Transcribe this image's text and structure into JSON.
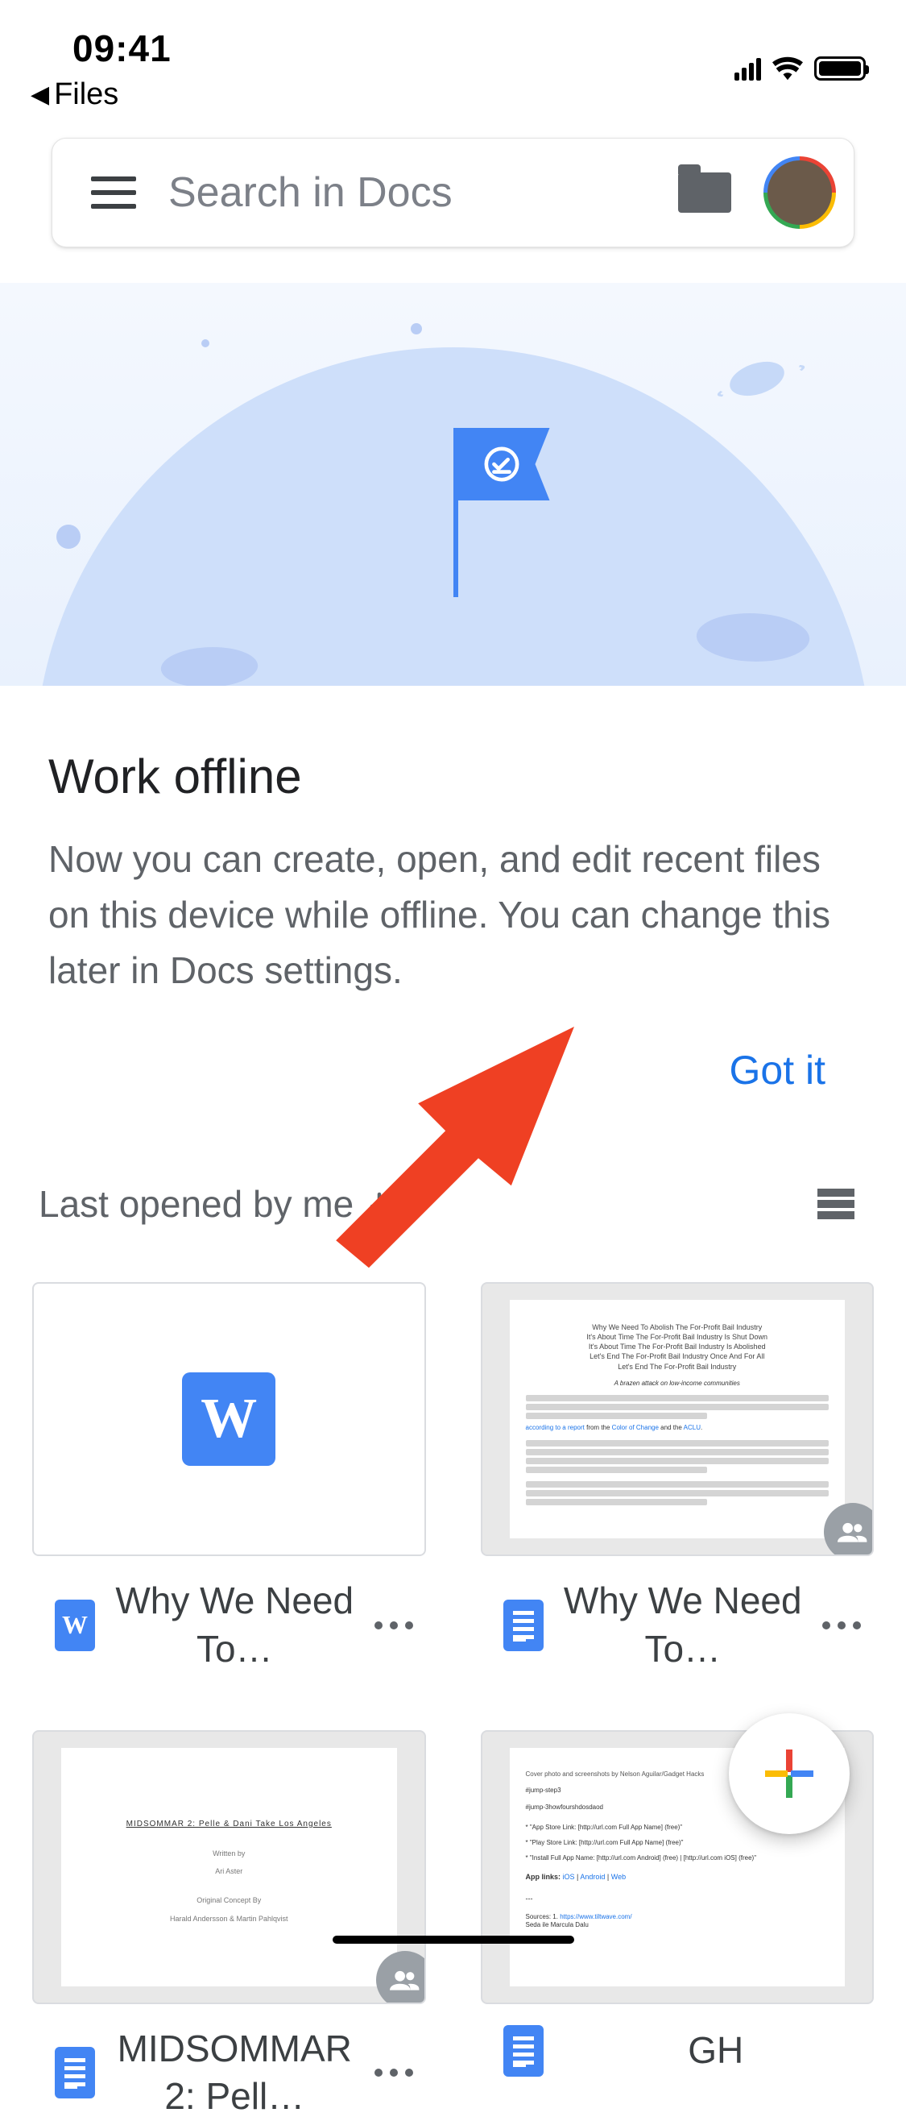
{
  "status_bar": {
    "time": "09:41",
    "back_label": "Files"
  },
  "search": {
    "placeholder": "Search in Docs"
  },
  "promo": {
    "title": "Work offline",
    "body": "Now you can create, open, and edit recent files on this device while offline. You can change this later in Docs settings.",
    "action": "Got it"
  },
  "sort": {
    "label": "Last opened by me"
  },
  "files": [
    {
      "title": "Why We Need To…",
      "icon": "word"
    },
    {
      "title": "Why We Need To…",
      "icon": "docs"
    },
    {
      "title": "MIDSOMMAR 2: Pell…",
      "icon": "docs"
    },
    {
      "title": "GH",
      "icon": "docs"
    }
  ],
  "icons": {
    "word_letter": "W"
  }
}
